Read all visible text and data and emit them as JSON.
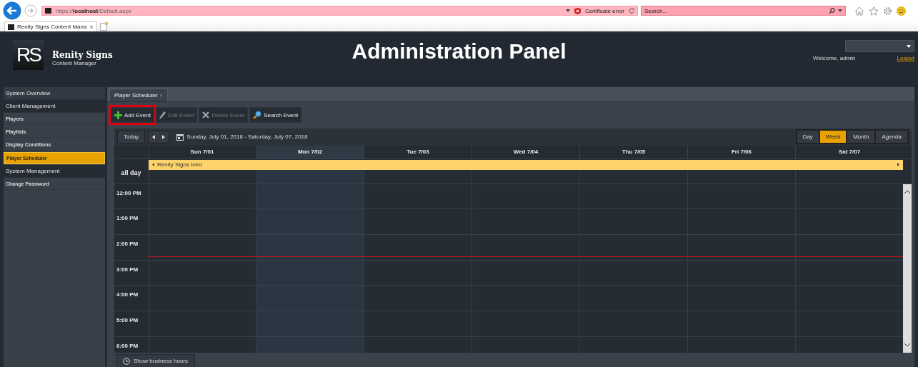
{
  "browser": {
    "url": "https://**localhost**/Default.aspx",
    "certificate": "Certificate error",
    "search": {
      "placeholder": "Search..."
    },
    "tab": {
      "title": "Renity Signs Content Mana",
      "close": "×"
    }
  },
  "header": {
    "logo": "RS",
    "brand": "Renity Signs",
    "subtitle": "Content Manager",
    "title": "Administration Panel",
    "welcome": "Welcome, admin",
    "logout": "Logout"
  },
  "sidebar": {
    "items": [
      {
        "label": "System Overview",
        "kind": "section",
        "selected": false
      },
      {
        "label": "Client Management",
        "kind": "section",
        "selected": false
      },
      {
        "label": "Players",
        "kind": "item",
        "selected": false
      },
      {
        "label": "Playlists",
        "kind": "item",
        "selected": false
      },
      {
        "label": "Display Conditions",
        "kind": "item",
        "selected": false
      },
      {
        "label": "Player Scheduler",
        "kind": "item",
        "selected": true
      },
      {
        "label": "System Management",
        "kind": "section",
        "selected": false
      },
      {
        "label": "Change Password",
        "kind": "item",
        "selected": false
      }
    ]
  },
  "tabs": [
    {
      "label": "Player Scheduler",
      "close": "×",
      "selected": true
    }
  ],
  "toolbar": [
    {
      "label": "Add Event",
      "kind": "add",
      "disabled": false,
      "highlighted": true
    },
    {
      "label": "Edit Event",
      "kind": "edit",
      "disabled": true,
      "highlighted": false
    },
    {
      "label": "Delete Event",
      "kind": "delete",
      "disabled": true,
      "highlighted": false
    },
    {
      "label": "Search Event",
      "kind": "search",
      "disabled": false,
      "highlighted": false
    }
  ],
  "calendar": {
    "today": "Today",
    "range": "Sunday, July 01, 2018 - Saturday, July 07, 2018",
    "views": [
      {
        "label": "Day",
        "selected": false
      },
      {
        "label": "Week",
        "selected": true
      },
      {
        "label": "Month",
        "selected": false
      },
      {
        "label": "Agenda",
        "selected": false
      }
    ],
    "days": [
      {
        "label": "Sun 7/01",
        "today": false
      },
      {
        "label": "Mon 7/02",
        "today": true
      },
      {
        "label": "Tue 7/03",
        "today": false
      },
      {
        "label": "Wed 7/04",
        "today": false
      },
      {
        "label": "Thu 7/05",
        "today": false
      },
      {
        "label": "Fri 7/06",
        "today": false
      },
      {
        "label": "Sat 7/07",
        "today": false
      }
    ],
    "all_day_label": "all day",
    "all_day_event": {
      "title": "Renity Signs Intro"
    },
    "hours": [
      "12:00 PM",
      "1:00 PM",
      "2:00 PM",
      "3:00 PM",
      "4:00 PM",
      "5:00 PM",
      "6:00 PM"
    ],
    "footer_button": "Show business hours"
  }
}
